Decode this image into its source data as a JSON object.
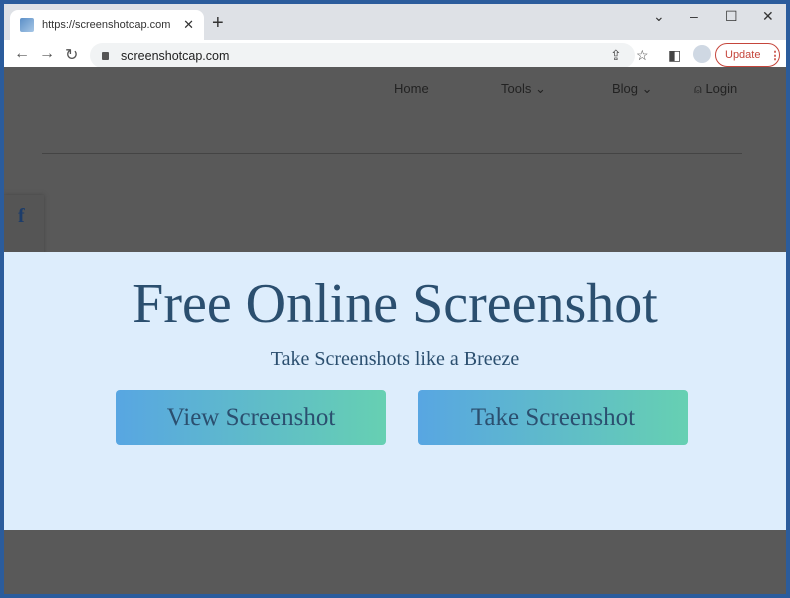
{
  "browser": {
    "tab_title": "https://screenshotcap.com",
    "url": "screenshotcap.com",
    "update_label": "Update"
  },
  "site": {
    "nav": {
      "home": "Home",
      "tools": "Tools",
      "blog": "Blog",
      "login": "Login"
    },
    "hero": {
      "title": "Free Online Screenshot",
      "subtitle": "Take Screenshots like a Breeze",
      "view_button": "View Screenshot",
      "take_button": "Take Screenshot"
    }
  }
}
